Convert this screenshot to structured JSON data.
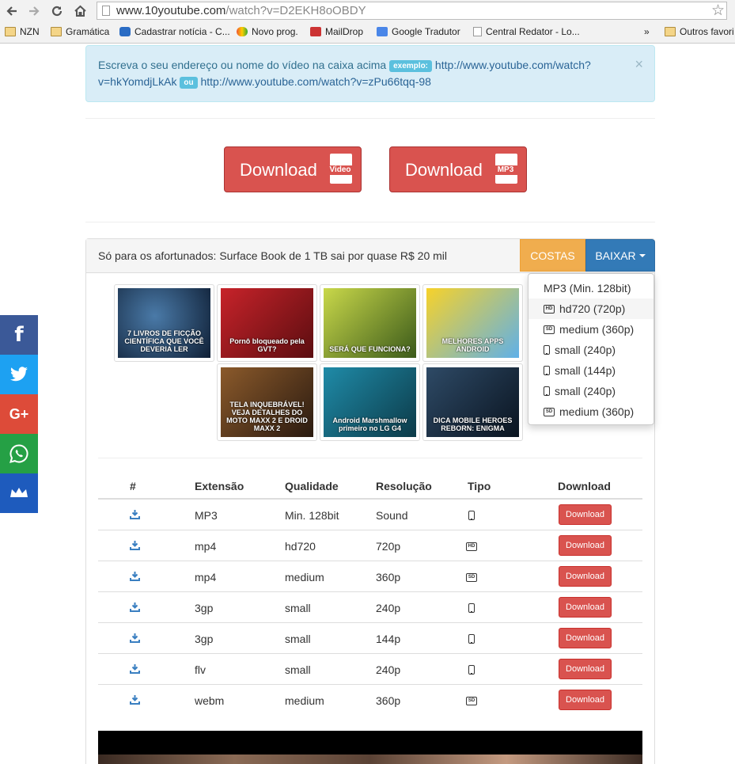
{
  "browser": {
    "url_host": "www.10youtube.com",
    "url_path": "/watch?v=D2EKH8oOBDY",
    "bookmarks": [
      {
        "label": "NZN",
        "icon": "folder-icon"
      },
      {
        "label": "Gramática",
        "icon": "folder-icon"
      },
      {
        "label": "Cadastrar notícia - C...",
        "icon": "site-icon"
      },
      {
        "label": "Novo prog.",
        "icon": "site-icon"
      },
      {
        "label": "MailDrop",
        "icon": "site-icon"
      },
      {
        "label": "Google Tradutor",
        "icon": "translate-icon"
      },
      {
        "label": "Central Redator - Lo...",
        "icon": "page-icon"
      }
    ],
    "more": "»",
    "other_bookmarks": "Outros favori"
  },
  "alert": {
    "text": "Escreva o seu endereço ou nome do vídeo na caixa acima",
    "tag1": "exemplo:",
    "link1_a": "http://www.youtube.com/watch?",
    "link1_b": "v=hkYomdjLkAk",
    "tag2": "ou",
    "link2": "http://www.youtube.com/watch?v=zPu66tqq-98",
    "close": "×"
  },
  "big_buttons": {
    "video_label": "Download",
    "video_type": "Video",
    "mp3_label": "Download",
    "mp3_type": "MP3"
  },
  "panel": {
    "title": "Só para os afortunados: Surface Book de 1 TB sai por quase R$ 20 mil",
    "costas": "COSTAS",
    "baixar": "BAIXAR"
  },
  "thumbnails": [
    {
      "caption": "7 LIVROS DE FICÇÃO CIENTÍFICA QUE VOCÊ DEVERIA LER",
      "bg": "#1d3a5c"
    },
    {
      "caption": "Pornô bloqueado pela GVT?",
      "bg": "#a4151b"
    },
    {
      "caption": "SERÁ QUE FUNCIONA?",
      "bg": "#6b8a1f"
    },
    {
      "caption": "MELHORES APPS ANDROID",
      "bg": "#e8b417"
    },
    {
      "caption": "TELA INQUEBRÁVEL! VEJA DETALHES DO MOTO MAXX 2 E DROID MAXX 2",
      "bg": "#6b3b1e"
    },
    {
      "caption": "Android Marshmallow primeiro no LG G4",
      "bg": "#0f5f74"
    },
    {
      "caption": "DICA MOBILE HEROES REBORN: ENIGMA",
      "bg": "#1a2a3a"
    }
  ],
  "dropdown": [
    {
      "label": "MP3 (Min. 128bit)",
      "icon": ""
    },
    {
      "label": "hd720 (720p)",
      "icon": "hd"
    },
    {
      "label": "medium (360p)",
      "icon": "sd"
    },
    {
      "label": "small (240p)",
      "icon": "phone"
    },
    {
      "label": "small (144p)",
      "icon": "phone"
    },
    {
      "label": "small (240p)",
      "icon": "phone"
    },
    {
      "label": "medium (360p)",
      "icon": "sd"
    }
  ],
  "table": {
    "headers": [
      "#",
      "Extensão",
      "Qualidade",
      "Resolução",
      "Tipo",
      "Download"
    ],
    "rows": [
      {
        "ext": "MP3",
        "quality": "Min. 128bit",
        "res": "Sound",
        "type": "phone",
        "button": "Download"
      },
      {
        "ext": "mp4",
        "quality": "hd720",
        "res": "720p",
        "type": "hd",
        "button": "Download"
      },
      {
        "ext": "mp4",
        "quality": "medium",
        "res": "360p",
        "type": "sd",
        "button": "Download"
      },
      {
        "ext": "3gp",
        "quality": "small",
        "res": "240p",
        "type": "phone",
        "button": "Download"
      },
      {
        "ext": "3gp",
        "quality": "small",
        "res": "144p",
        "type": "phone",
        "button": "Download"
      },
      {
        "ext": "flv",
        "quality": "small",
        "res": "240p",
        "type": "phone",
        "button": "Download"
      },
      {
        "ext": "webm",
        "quality": "medium",
        "res": "360p",
        "type": "sd",
        "button": "Download"
      }
    ]
  },
  "icon_labels": {
    "hd": "HD",
    "sd": "SD"
  },
  "social": [
    {
      "name": "facebook",
      "color": "#3b5998",
      "glyph": "f"
    },
    {
      "name": "twitter",
      "color": "#1da1f2",
      "glyph": ""
    },
    {
      "name": "google-plus",
      "color": "#dd4b39",
      "glyph": "G+"
    },
    {
      "name": "whatsapp",
      "color": "#25a045",
      "glyph": ""
    },
    {
      "name": "sumome",
      "color": "#1e5bbd",
      "glyph": ""
    }
  ],
  "colors": {
    "danger": "#d9534f",
    "warning": "#f0ad4e",
    "primary": "#337ab7",
    "info_bg": "#d9edf7",
    "download_icon": "#3a7fc1"
  }
}
